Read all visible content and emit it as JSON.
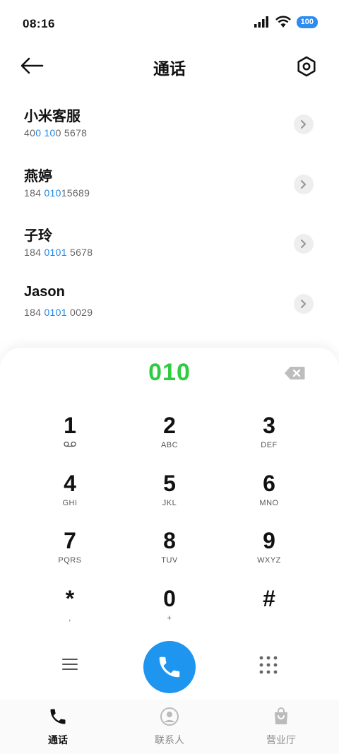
{
  "status": {
    "time": "08:16",
    "battery": "100"
  },
  "header": {
    "title": "通话"
  },
  "contacts": [
    {
      "name": "小米客服",
      "num_pre": "40",
      "num_hl": "0 10",
      "num_post": "0 5678"
    },
    {
      "name": "燕婷",
      "num_pre": "184 ",
      "num_hl": "010",
      "num_post": "15689"
    },
    {
      "name": "子玲",
      "num_pre": "184 ",
      "num_hl": "0101",
      "num_post": " 5678"
    },
    {
      "name": "Jason",
      "num_pre": "184 ",
      "num_hl": "0101",
      "num_post": " 0029"
    }
  ],
  "dialer": {
    "number": "010",
    "keys": [
      {
        "digit": "1",
        "letters": ""
      },
      {
        "digit": "2",
        "letters": "ABC"
      },
      {
        "digit": "3",
        "letters": "DEF"
      },
      {
        "digit": "4",
        "letters": "GHI"
      },
      {
        "digit": "5",
        "letters": "JKL"
      },
      {
        "digit": "6",
        "letters": "MNO"
      },
      {
        "digit": "7",
        "letters": "PQRS"
      },
      {
        "digit": "8",
        "letters": "TUV"
      },
      {
        "digit": "9",
        "letters": "WXYZ"
      },
      {
        "digit": "*",
        "letters": ","
      },
      {
        "digit": "0",
        "letters": "+"
      },
      {
        "digit": "#",
        "letters": ""
      }
    ]
  },
  "tabs": [
    {
      "label": "通话",
      "icon": "phone-icon",
      "active": true
    },
    {
      "label": "联系人",
      "icon": "person-icon",
      "active": false
    },
    {
      "label": "营业厅",
      "icon": "shopping-bag-icon",
      "active": false
    }
  ],
  "colors": {
    "accent": "#1e96f0",
    "dialed": "#2ecc40",
    "highlight": "#1e88e5"
  }
}
